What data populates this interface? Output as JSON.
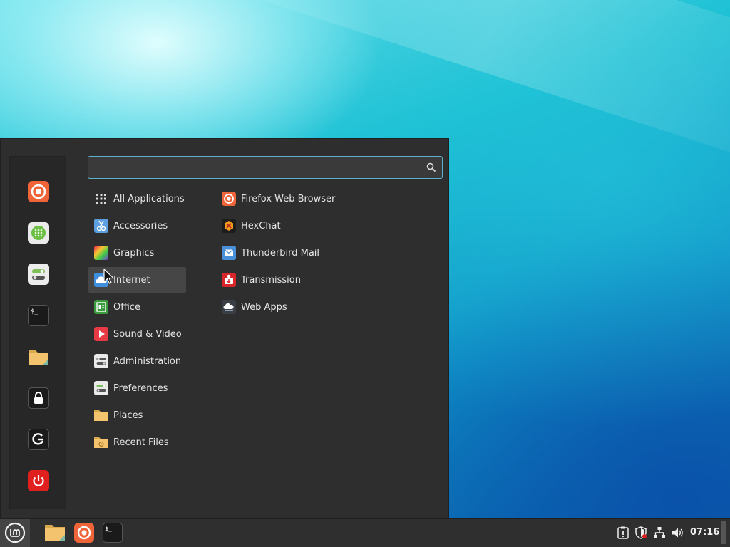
{
  "search": {
    "value": "",
    "placeholder": ""
  },
  "favorites": [
    {
      "name": "firefox",
      "icon": "firefox-icon"
    },
    {
      "name": "software-manager",
      "icon": "software-manager-icon"
    },
    {
      "name": "system-settings",
      "icon": "settings-toggle-icon"
    },
    {
      "name": "terminal",
      "icon": "terminal-icon",
      "glyph": "$_"
    },
    {
      "name": "files",
      "icon": "folder-icon"
    },
    {
      "name": "lock-screen",
      "icon": "lock-icon"
    },
    {
      "name": "logout",
      "icon": "logout-icon"
    },
    {
      "name": "shutdown",
      "icon": "power-icon"
    }
  ],
  "categories": [
    {
      "label": "All Applications",
      "icon": "grid-icon"
    },
    {
      "label": "Accessories",
      "icon": "scissors-icon"
    },
    {
      "label": "Graphics",
      "icon": "graphics-icon"
    },
    {
      "label": "Internet",
      "icon": "cloud-icon",
      "selected": true
    },
    {
      "label": "Office",
      "icon": "office-icon"
    },
    {
      "label": "Sound & Video",
      "icon": "play-icon"
    },
    {
      "label": "Administration",
      "icon": "administration-icon"
    },
    {
      "label": "Preferences",
      "icon": "preferences-icon"
    },
    {
      "label": "Places",
      "icon": "folder-icon"
    },
    {
      "label": "Recent Files",
      "icon": "recent-folder-icon"
    }
  ],
  "apps": [
    {
      "label": "Firefox Web Browser",
      "icon": "firefox-icon"
    },
    {
      "label": "HexChat",
      "icon": "hexchat-icon"
    },
    {
      "label": "Thunderbird Mail",
      "icon": "thunderbird-icon"
    },
    {
      "label": "Transmission",
      "icon": "transmission-icon"
    },
    {
      "label": "Web Apps",
      "icon": "web-apps-icon"
    }
  ],
  "panel": {
    "menu_icon": "mint-logo-icon",
    "launchers": [
      {
        "name": "files",
        "icon": "folder-icon"
      },
      {
        "name": "firefox",
        "icon": "firefox-icon"
      },
      {
        "name": "terminal",
        "icon": "terminal-icon",
        "glyph": "$_"
      }
    ],
    "tray": [
      "update-manager-icon",
      "shield-icon",
      "network-icon",
      "volume-icon"
    ],
    "clock": "07:16"
  },
  "colors": {
    "menu_bg": "#2e2e2e",
    "selected_bg": "#464646",
    "search_border": "#5fb0c9",
    "panel_bg": "#2f2f2f"
  }
}
